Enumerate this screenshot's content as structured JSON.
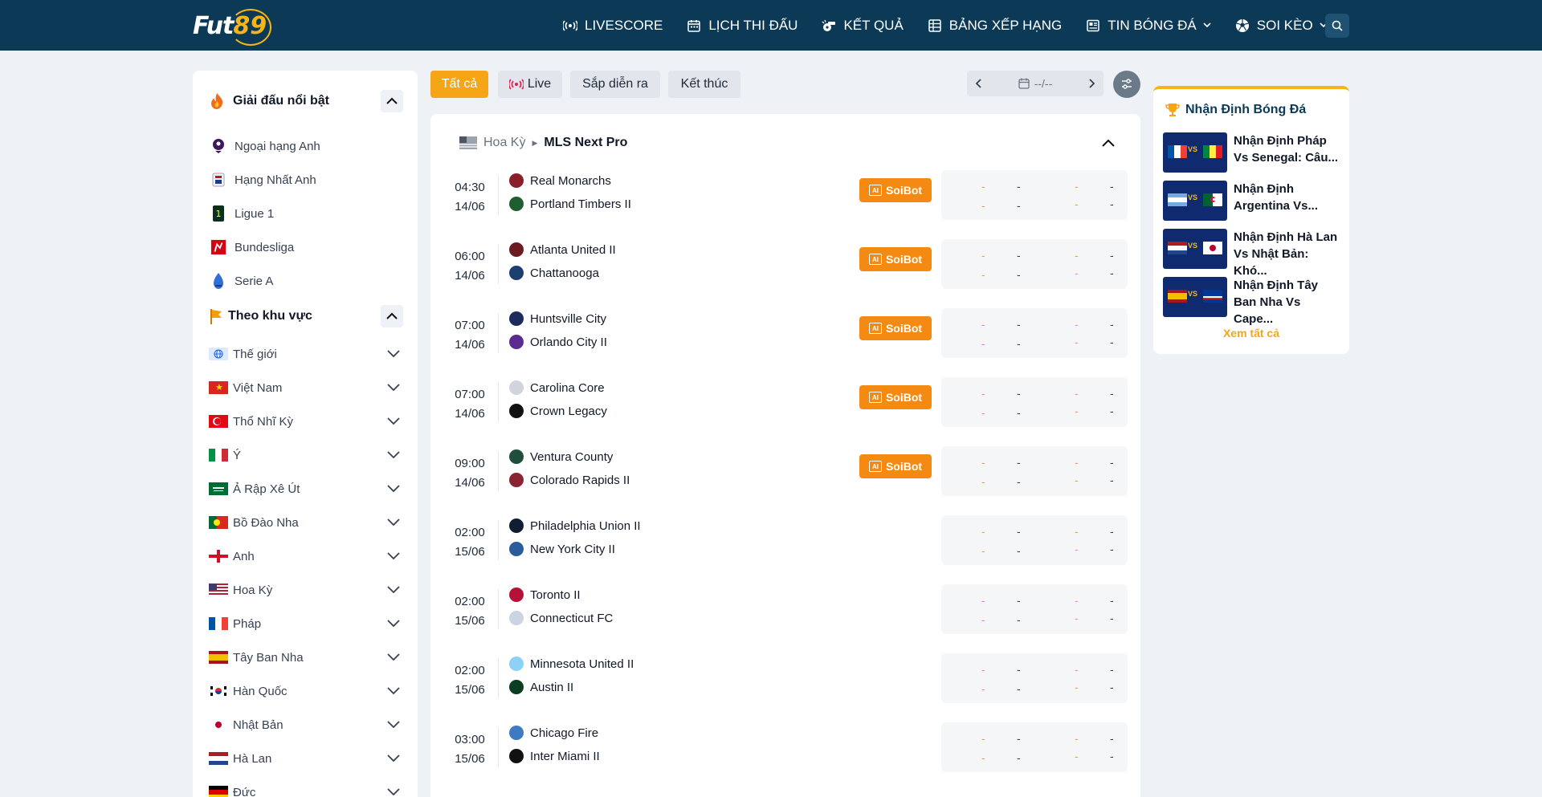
{
  "header": {
    "logo_text": "Fut",
    "logo_num": "89",
    "nav": [
      {
        "label": "LIVESCORE",
        "icon": "live-signal-icon",
        "has_dropdown": false
      },
      {
        "label": "LỊCH THI ĐẤU",
        "icon": "calendar-icon",
        "has_dropdown": false
      },
      {
        "label": "KẾT QUẢ",
        "icon": "whistle-icon",
        "has_dropdown": false
      },
      {
        "label": "BẢNG XẾP HẠNG",
        "icon": "table-icon",
        "has_dropdown": false
      },
      {
        "label": "TIN BÓNG ĐÁ",
        "icon": "news-icon",
        "has_dropdown": true
      },
      {
        "label": "SOI KÈO",
        "icon": "ball-icon",
        "has_dropdown": true
      }
    ],
    "search_icon": "search-icon"
  },
  "sidebar": {
    "featured_title": "Giải đấu nổi bật",
    "featured": [
      {
        "label": "Ngoại hạng Anh",
        "color": "#3d195b"
      },
      {
        "label": "Hạng Nhất Anh",
        "color": "#c8102e"
      },
      {
        "label": "Ligue 1",
        "color": "#0b2f1a"
      },
      {
        "label": "Bundesliga",
        "color": "#d20515"
      },
      {
        "label": "Serie A",
        "color": "#2f6fd6"
      }
    ],
    "region_title": "Theo khu vực",
    "regions": [
      {
        "label": "Thế giới",
        "flag": "world"
      },
      {
        "label": "Việt Nam",
        "flag": "vn"
      },
      {
        "label": "Thổ Nhĩ Kỳ",
        "flag": "tr"
      },
      {
        "label": "Ý",
        "flag": "it"
      },
      {
        "label": "Ả Rập Xê Út",
        "flag": "sa"
      },
      {
        "label": "Bồ Đào Nha",
        "flag": "pt"
      },
      {
        "label": "Anh",
        "flag": "en"
      },
      {
        "label": "Hoa Kỳ",
        "flag": "us"
      },
      {
        "label": "Pháp",
        "flag": "fr"
      },
      {
        "label": "Tây Ban Nha",
        "flag": "es"
      },
      {
        "label": "Hàn Quốc",
        "flag": "kr"
      },
      {
        "label": "Nhật Bản",
        "flag": "jp"
      },
      {
        "label": "Hà Lan",
        "flag": "nl"
      },
      {
        "label": "Đức",
        "flag": "de"
      }
    ]
  },
  "filters": {
    "all": "Tất cả",
    "live": "Live",
    "upcoming": "Sắp diễn ra",
    "finished": "Kết thúc",
    "date": "--/--"
  },
  "league": {
    "country": "Hoa Kỳ",
    "name": "MLS Next Pro"
  },
  "soibot_label": "SoiBot",
  "ai_label": "AI",
  "odds_placeholder": "-",
  "matches": [
    {
      "time": "04:30",
      "date": "14/06",
      "home": "Real Monarchs",
      "away": "Portland Timbers II",
      "soibot": true,
      "home_color": "#8a1f2b",
      "away_color": "#1f5d32"
    },
    {
      "time": "06:00",
      "date": "14/06",
      "home": "Atlanta United II",
      "away": "Chattanooga",
      "soibot": true,
      "home_color": "#6b1b22",
      "away_color": "#1c3f6e"
    },
    {
      "time": "07:00",
      "date": "14/06",
      "home": "Huntsville City",
      "away": "Orlando City II",
      "soibot": true,
      "home_color": "#1d2b5c",
      "away_color": "#5b2c8f"
    },
    {
      "time": "07:00",
      "date": "14/06",
      "home": "Carolina Core",
      "away": "Crown Legacy",
      "soibot": true,
      "home_color": "#d1d5db",
      "away_color": "#111111"
    },
    {
      "time": "09:00",
      "date": "14/06",
      "home": "Ventura County",
      "away": "Colorado Rapids II",
      "soibot": true,
      "home_color": "#1f4e3d",
      "away_color": "#8a2432"
    },
    {
      "time": "02:00",
      "date": "15/06",
      "home": "Philadelphia Union II",
      "away": "New York City II",
      "soibot": false,
      "home_color": "#0f1e33",
      "away_color": "#2c5b9c"
    },
    {
      "time": "02:00",
      "date": "15/06",
      "home": "Toronto II",
      "away": "Connecticut FC",
      "soibot": false,
      "home_color": "#b81137",
      "away_color": "#cbd5e1"
    },
    {
      "time": "02:00",
      "date": "15/06",
      "home": "Minnesota United II",
      "away": "Austin II",
      "soibot": false,
      "home_color": "#8cd2f4",
      "away_color": "#0b3d22"
    },
    {
      "time": "03:00",
      "date": "15/06",
      "home": "Chicago Fire",
      "away": "Inter Miami II",
      "soibot": false,
      "home_color": "#3f79c2",
      "away_color": "#111111"
    }
  ],
  "predictions": {
    "title": "Nhận Định Bóng Đá",
    "see_all": "Xem tất cả",
    "items": [
      {
        "text": "Nhận Định Pháp Vs Senegal: Câu...",
        "flag_a": "fr",
        "flag_b": "sn"
      },
      {
        "text": "Nhận Định Argentina Vs...",
        "flag_a": "ar",
        "flag_b": "dz"
      },
      {
        "text": "Nhận Định Hà Lan Vs Nhật Bản: Khó...",
        "flag_a": "nl",
        "flag_b": "jp"
      },
      {
        "text": "Nhận Định Tây Ban Nha Vs Cape...",
        "flag_a": "es",
        "flag_b": "cv"
      }
    ],
    "vs": "VS"
  }
}
